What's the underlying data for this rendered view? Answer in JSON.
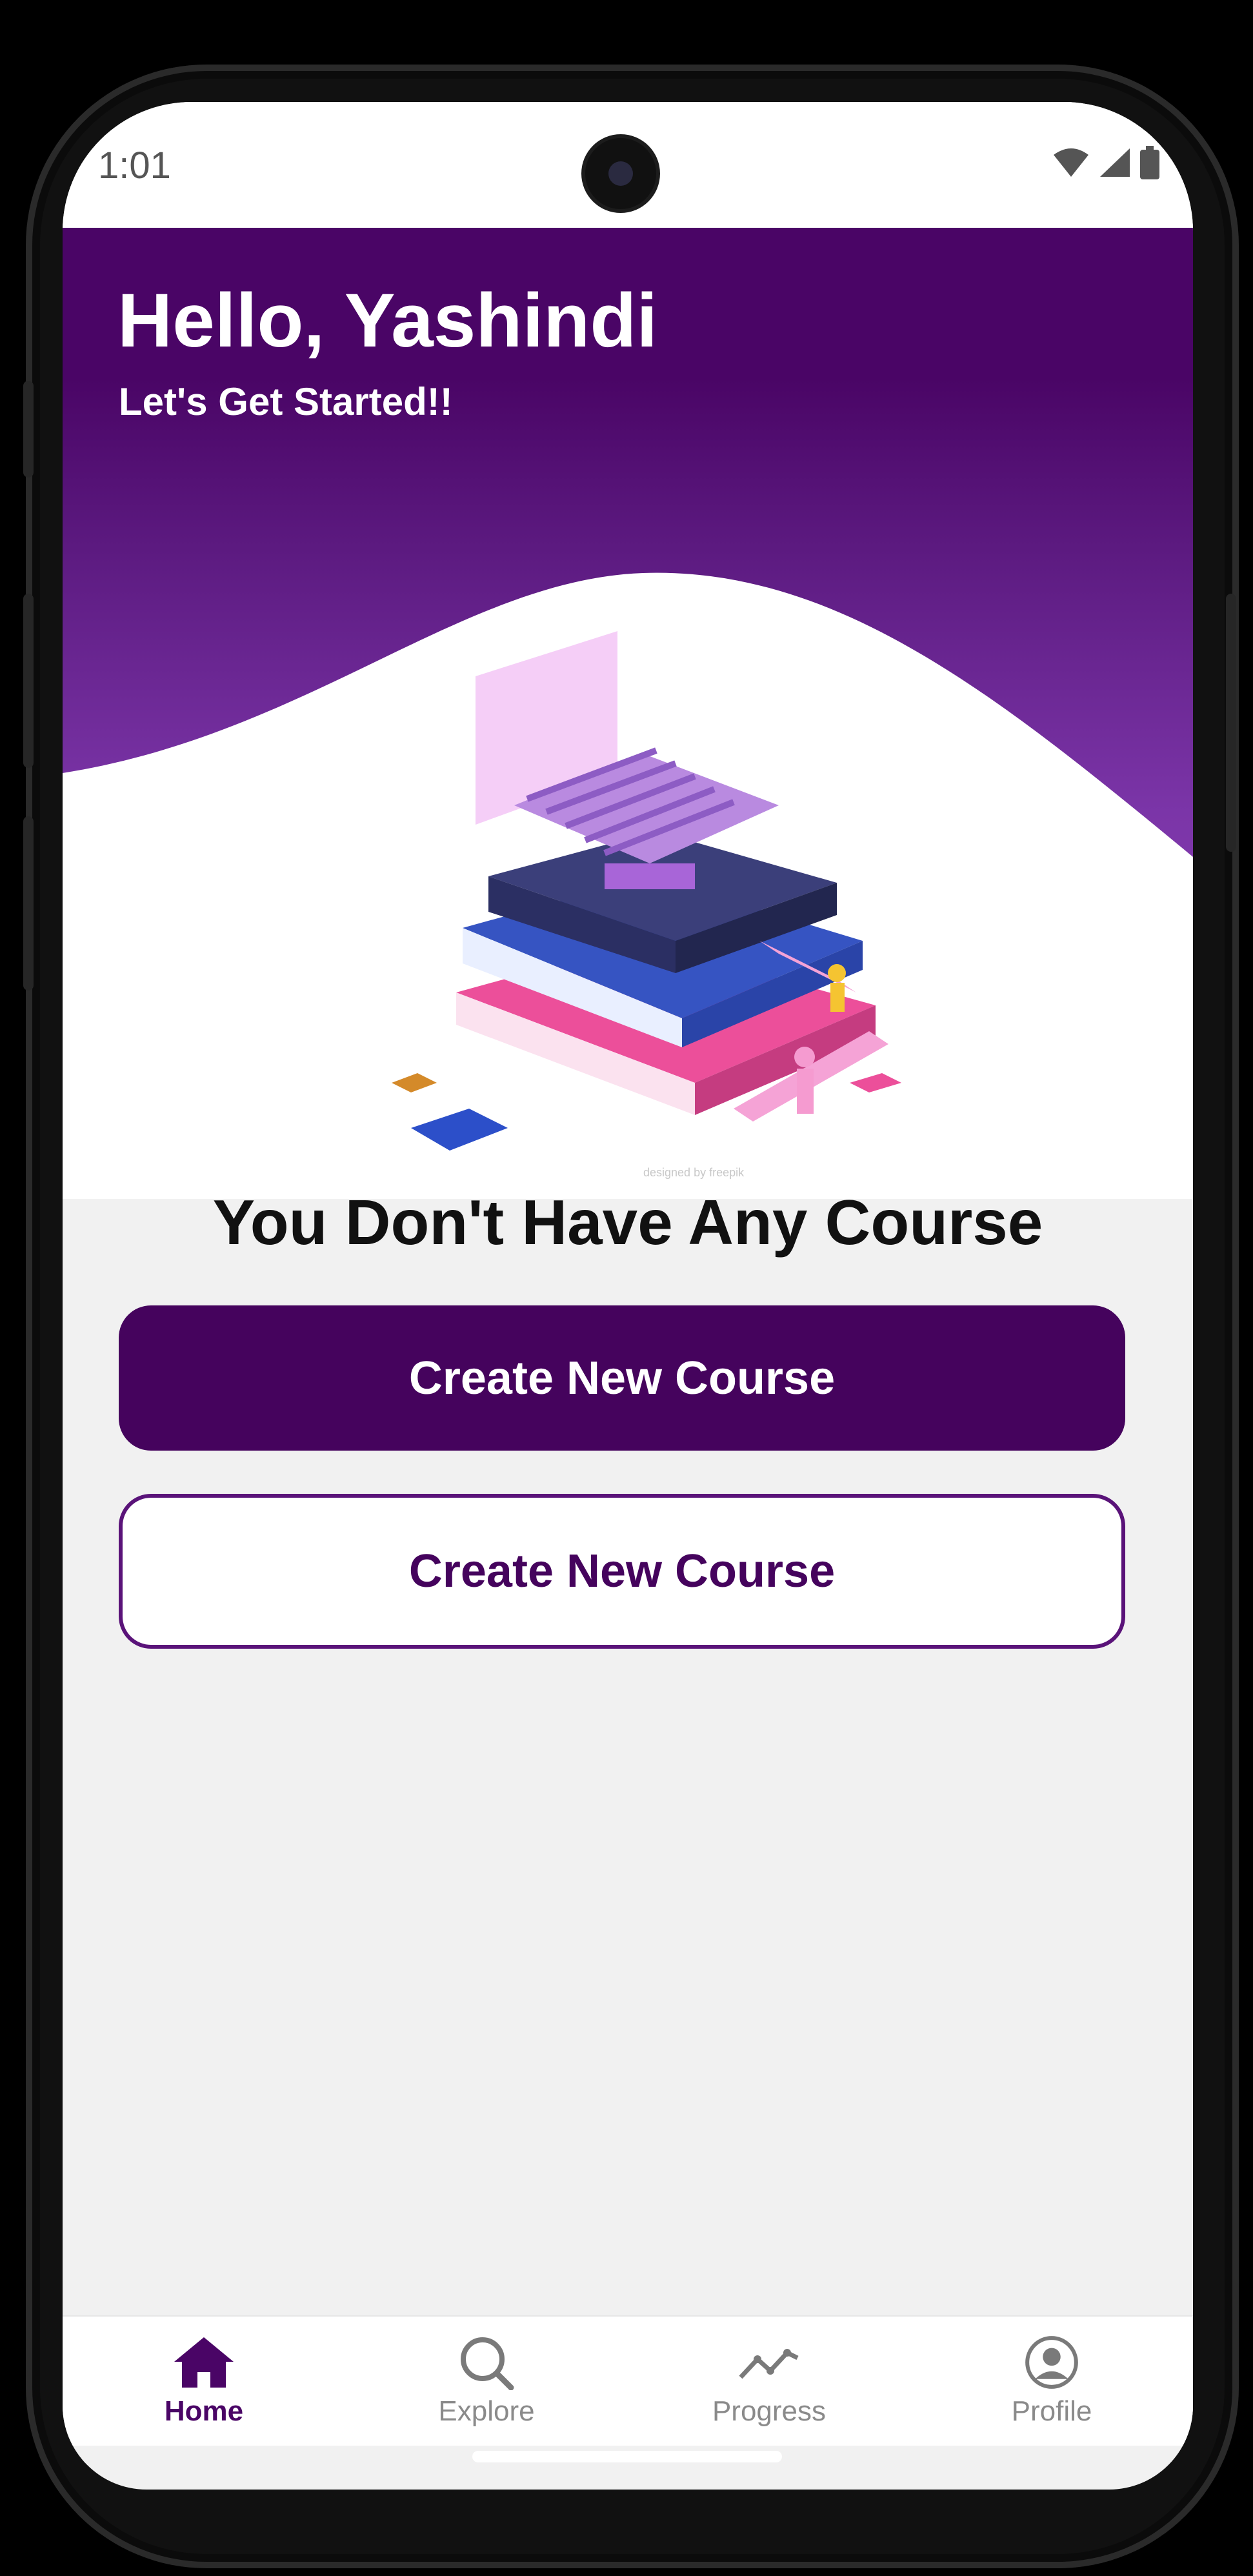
{
  "status_bar": {
    "time": "1:01"
  },
  "header": {
    "greeting": "Hello, Yashindi",
    "subtitle": "Let's Get Started!!"
  },
  "illustration": {
    "credit": "designed by freepik"
  },
  "main": {
    "empty_title": "You Don't Have Any Course",
    "primary_button": "Create New Course",
    "secondary_button": "Create New Course"
  },
  "bottom_nav": {
    "items": [
      {
        "label": "Home",
        "icon": "home-icon",
        "active": true
      },
      {
        "label": "Explore",
        "icon": "search-icon",
        "active": false
      },
      {
        "label": "Progress",
        "icon": "progress-icon",
        "active": false
      },
      {
        "label": "Profile",
        "icon": "profile-icon",
        "active": false
      }
    ]
  },
  "colors": {
    "brand_primary": "#45035d",
    "header_gradient_top": "#4a0566",
    "header_gradient_bottom": "#9244b8",
    "nav_inactive": "#8a8a8a"
  }
}
